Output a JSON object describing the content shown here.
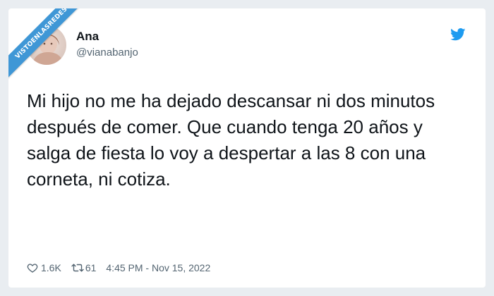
{
  "watermark": {
    "text": "VISTOENLASREDES"
  },
  "tweet": {
    "author": {
      "name": "Ana",
      "handle": "@vianabanjo"
    },
    "text": "Mi hijo no me ha dejado descansar ni dos minutos después de comer. Que cuando tenga 20 años y salga de fiesta lo voy a despertar a las 8 con una corneta, ni cotiza.",
    "likes": "1.6K",
    "retweets": "61",
    "timestamp": "4:45 PM - Nov 15, 2022"
  },
  "icons": {
    "brand": "twitter-bird-icon",
    "like": "heart-icon",
    "retweet": "retweet-icon"
  },
  "colors": {
    "twitter_blue": "#1d9bf0",
    "watermark_blue": "#3f97d6",
    "text_primary": "#0f1419",
    "text_secondary": "#536471"
  }
}
